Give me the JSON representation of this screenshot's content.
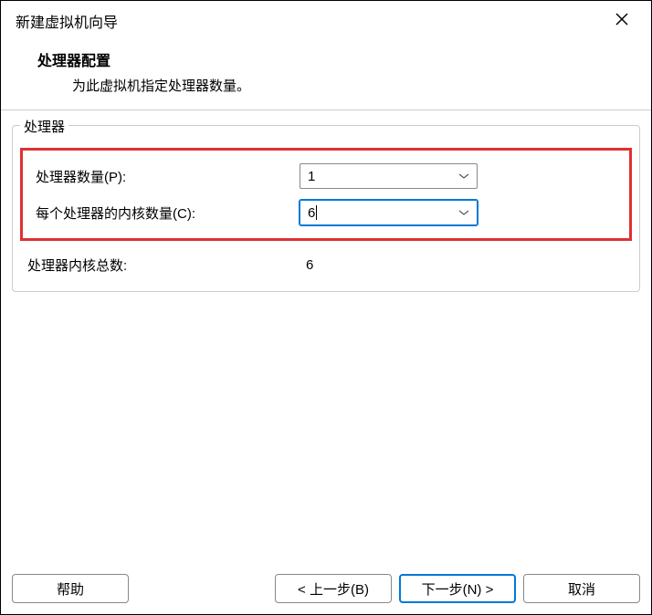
{
  "window": {
    "title": "新建虚拟机向导"
  },
  "header": {
    "title": "处理器配置",
    "subtitle": "为此虚拟机指定处理器数量。"
  },
  "fieldset": {
    "legend": "处理器"
  },
  "form": {
    "processors_label": "处理器数量(P):",
    "processors_value": "1",
    "cores_label": "每个处理器的内核数量(C):",
    "cores_value": "6",
    "total_label": "处理器内核总数:",
    "total_value": "6"
  },
  "buttons": {
    "help": "帮助",
    "back": "< 上一步(B)",
    "next": "下一步(N) >",
    "cancel": "取消"
  }
}
